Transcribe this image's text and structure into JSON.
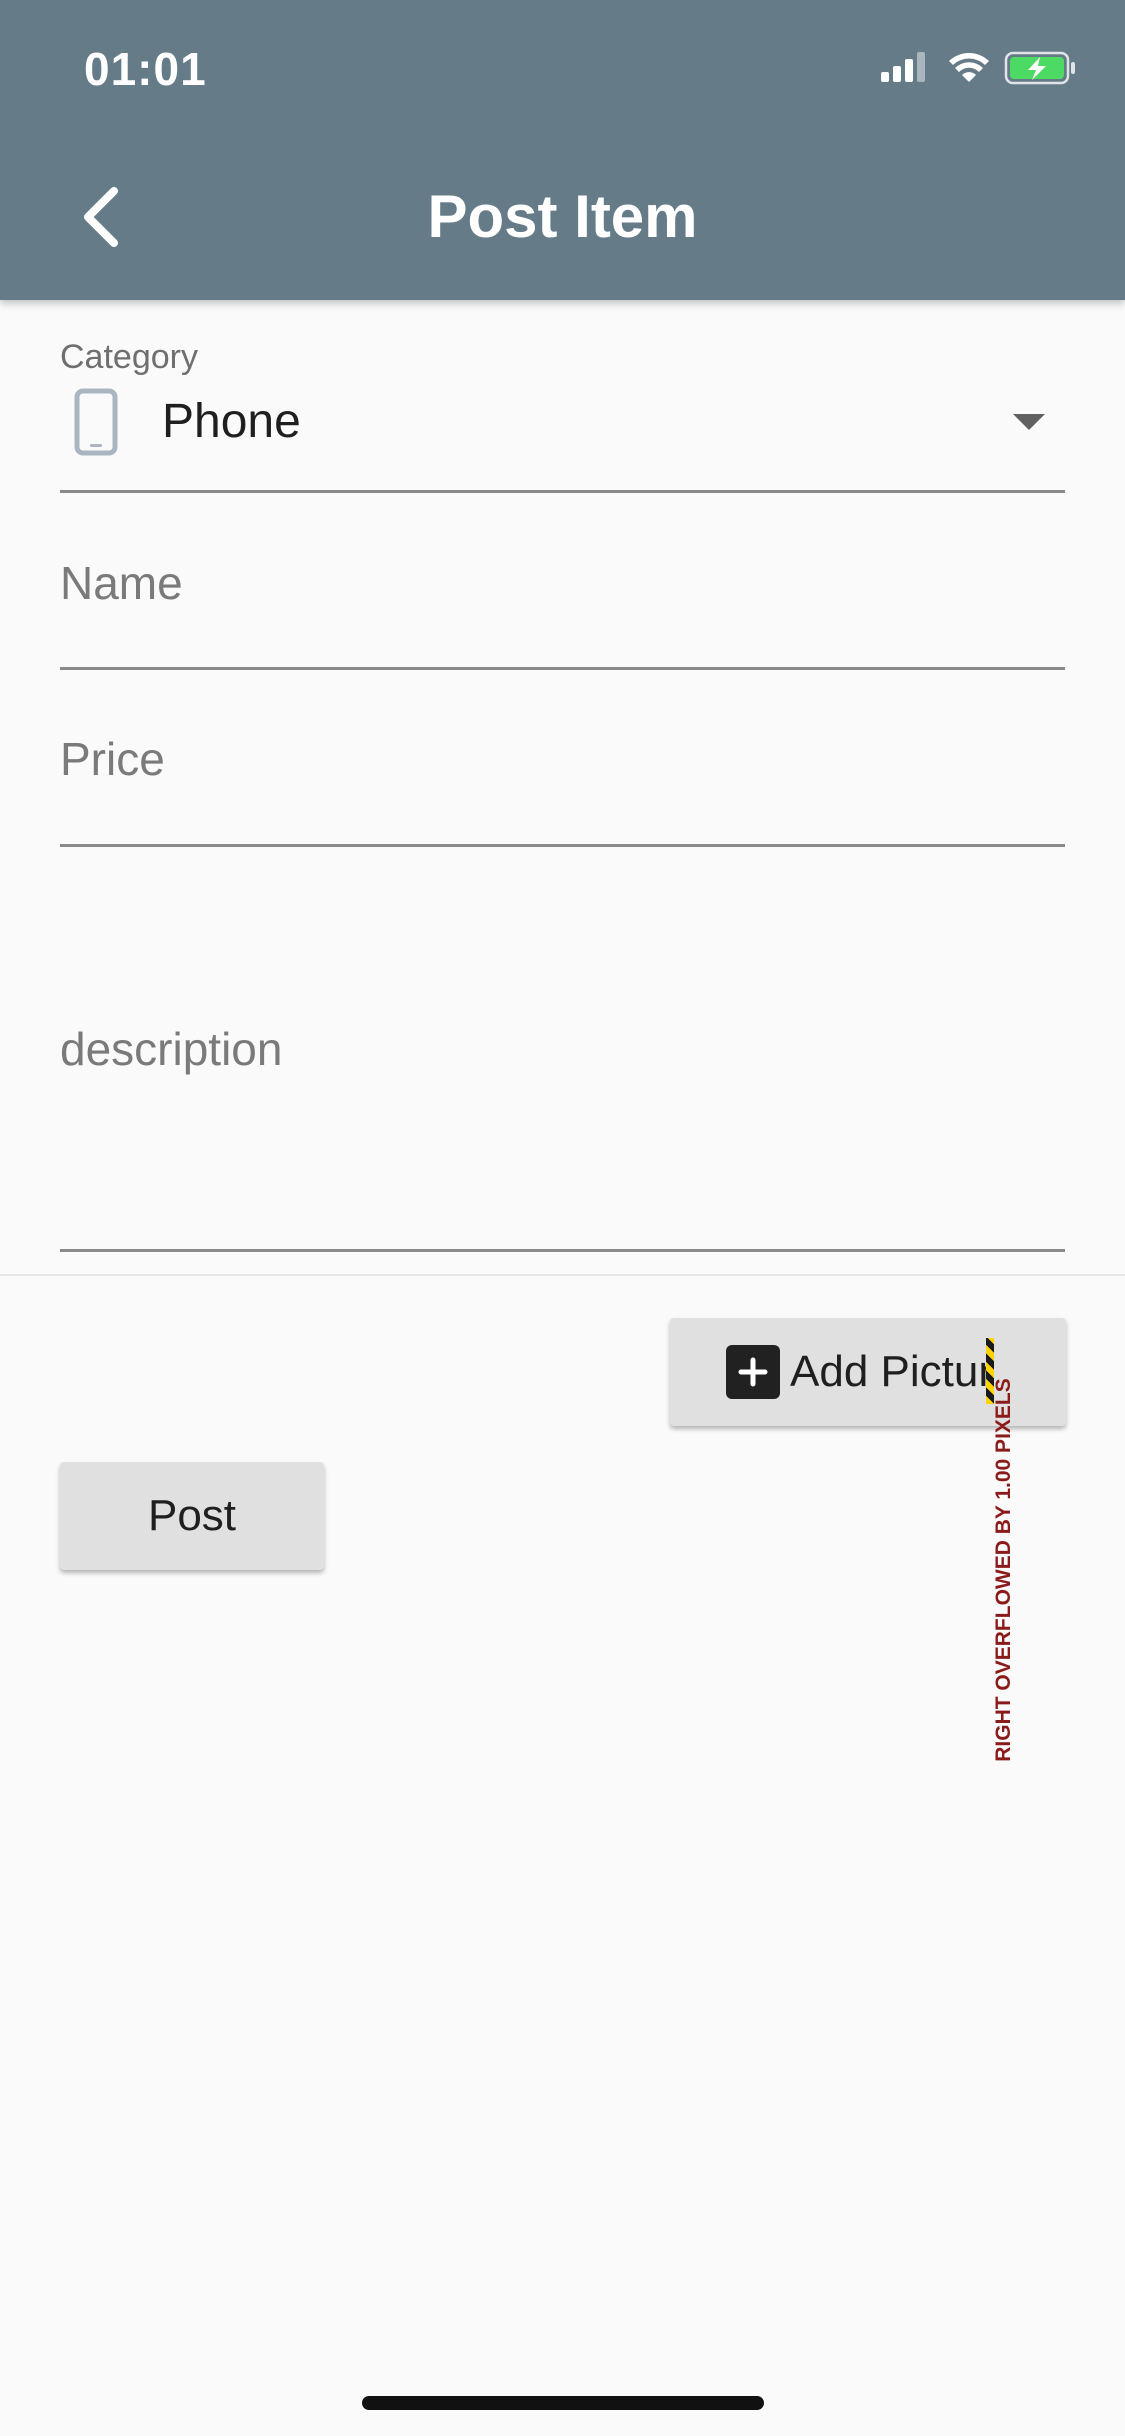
{
  "status_bar": {
    "time": "01:01",
    "icons": [
      "signal-icon",
      "wifi-icon",
      "battery-charging-icon"
    ]
  },
  "app_bar": {
    "title": "Post Item",
    "back_icon": "chevron-left-icon",
    "background_color": "#657b88"
  },
  "form": {
    "category": {
      "label": "Category",
      "selected_value": "Phone",
      "icon": "smartphone-icon"
    },
    "name": {
      "placeholder": "Name",
      "value": ""
    },
    "price": {
      "placeholder": "Price",
      "value": ""
    },
    "description": {
      "placeholder": "description",
      "value": ""
    }
  },
  "buttons": {
    "add_picture_label": "Add Picture",
    "add_picture_icon": "add-box-icon",
    "post_label": "Post"
  },
  "debug_overlay": {
    "overflow_text": "RIGHT OVERFLOWED BY 1.00 PIXELS"
  }
}
